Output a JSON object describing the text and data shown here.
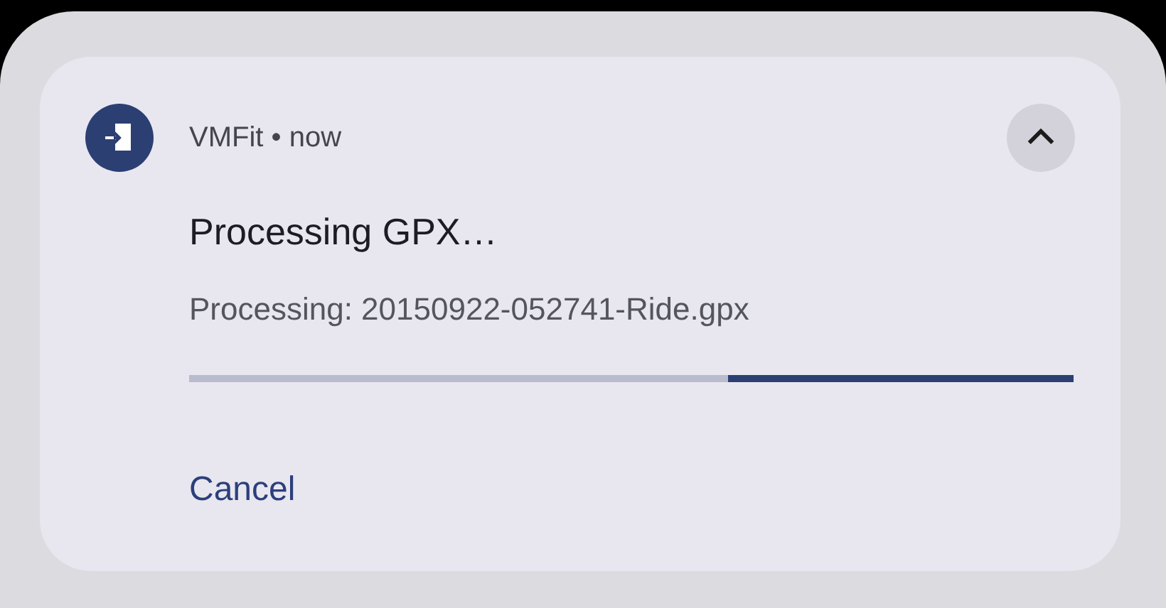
{
  "notification": {
    "app_name": "VMFit",
    "separator": "•",
    "time": "now",
    "expanded": true,
    "title": "Processing GPX…",
    "text": "Processing: 20150922-052741-Ride.gpx",
    "progress": {
      "level": 0.39
    },
    "actions": [
      "Cancel"
    ]
  }
}
